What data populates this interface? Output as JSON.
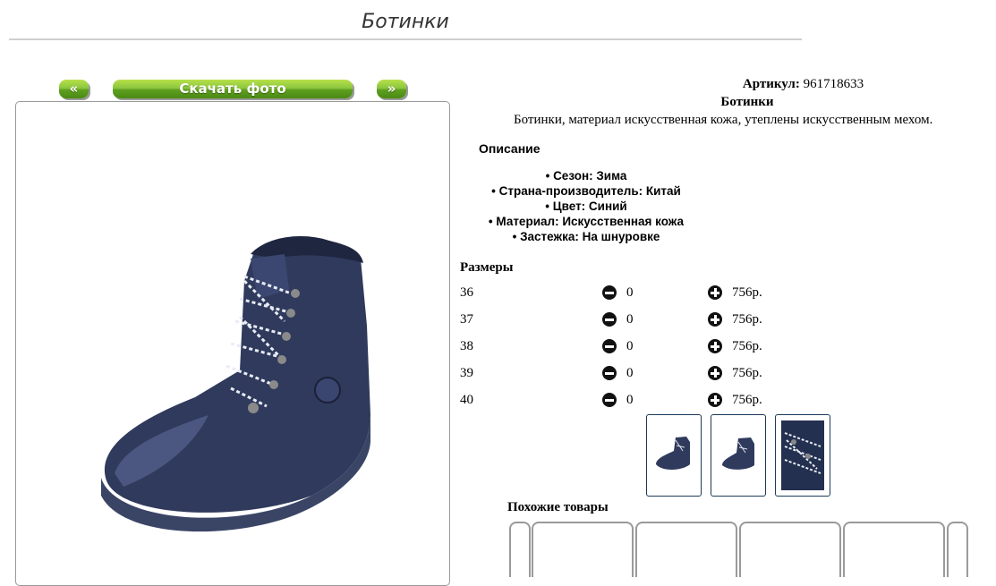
{
  "page": {
    "title": "Ботинки"
  },
  "gallery": {
    "prev_label": "«",
    "download_label": "Скачать фото",
    "next_label": "»"
  },
  "product": {
    "article_label": "Артикул:",
    "article_value": "961718633",
    "name": "Ботинки",
    "short_description": "Ботинки, материал искусственная кожа, утеплены искусственным мехом."
  },
  "description": {
    "heading": "Описание",
    "features": [
      "Сезон: Зима",
      "Страна-производитель: Китай",
      "Цвет: Синий",
      "Материал: Искусственная кожа",
      "Застежка: На шнуровке"
    ]
  },
  "sizes": {
    "heading": "Размеры",
    "rows": [
      {
        "size": "36",
        "qty": "0",
        "price": "756р."
      },
      {
        "size": "37",
        "qty": "0",
        "price": "756р."
      },
      {
        "size": "38",
        "qty": "0",
        "price": "756р."
      },
      {
        "size": "39",
        "qty": "0",
        "price": "756р."
      },
      {
        "size": "40",
        "qty": "0",
        "price": "756р."
      }
    ]
  },
  "thumbnails": [
    "boot-side-view",
    "boot-angle-view",
    "boot-laces-closeup"
  ],
  "similar": {
    "heading": "Похожие товары"
  },
  "colors": {
    "button_green": "#8cc63f",
    "boot_navy": "#2f3a5c",
    "thumb_border": "#1c3a5a"
  }
}
